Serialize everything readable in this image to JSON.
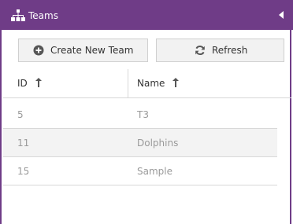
{
  "header": {
    "title": "Teams",
    "icon": "sitemap-icon",
    "collapse_icon": "triangle-left-icon"
  },
  "toolbar": {
    "create_label": "Create New Team",
    "create_icon": "plus-circle-icon",
    "refresh_label": "Refresh",
    "refresh_icon": "refresh-icon"
  },
  "table": {
    "columns": [
      {
        "label": "ID",
        "sort": "ascending"
      },
      {
        "label": "Name",
        "sort": "ascending"
      }
    ],
    "rows": [
      {
        "id": "5",
        "name": "T3"
      },
      {
        "id": "11",
        "name": "Dolphins"
      },
      {
        "id": "15",
        "name": "Sample"
      }
    ]
  },
  "colors": {
    "header_bg": "#6f3c87",
    "header_text": "#ffffff",
    "row_alt_bg": "#f3f3f3",
    "cell_text": "#9a9a9a"
  }
}
